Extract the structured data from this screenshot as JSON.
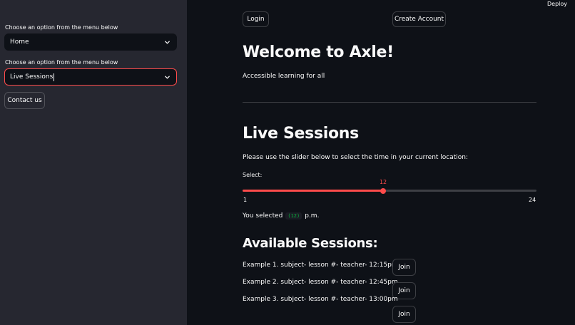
{
  "header": {
    "deploy_label": "Deploy"
  },
  "sidebar": {
    "menu1": {
      "label": "Choose an option from the menu below",
      "value": "Home"
    },
    "menu2": {
      "label": "Choose an option from the menu below",
      "value": "Live Sessions"
    },
    "contact_label": "Contact us"
  },
  "top_buttons": {
    "login": "Login",
    "create_account": "Create Account"
  },
  "main": {
    "title": "Welcome to Axle!",
    "tagline": "Accessible learning for all",
    "live_title": "Live Sessions",
    "instructions": "Please use the slider below to select the time in your current location:",
    "slider": {
      "label": "Select:",
      "min": 1,
      "max": 24,
      "value": 12,
      "min_label": "1",
      "max_label": "24",
      "value_label": "12"
    },
    "selected": {
      "prefix": "You selected",
      "code": "(12)",
      "suffix": "p.m."
    },
    "sessions_title": "Available Sessions:",
    "sessions": [
      {
        "text": "Example 1. subject- lesson #- teacher- 12:15pm",
        "join": "Join"
      },
      {
        "text": "Example 2. subject- lesson #- teacher- 12:45pm",
        "join": "Join"
      },
      {
        "text": "Example 3. subject- lesson #- teacher- 13:00pm",
        "join": "Join"
      }
    ]
  },
  "colors": {
    "accent": "#ff4b4b",
    "background": "#0e1117",
    "sidebar": "#262730",
    "code": "#09ab3b"
  },
  "icons": {
    "select_arrow": "chevron-down-icon"
  }
}
